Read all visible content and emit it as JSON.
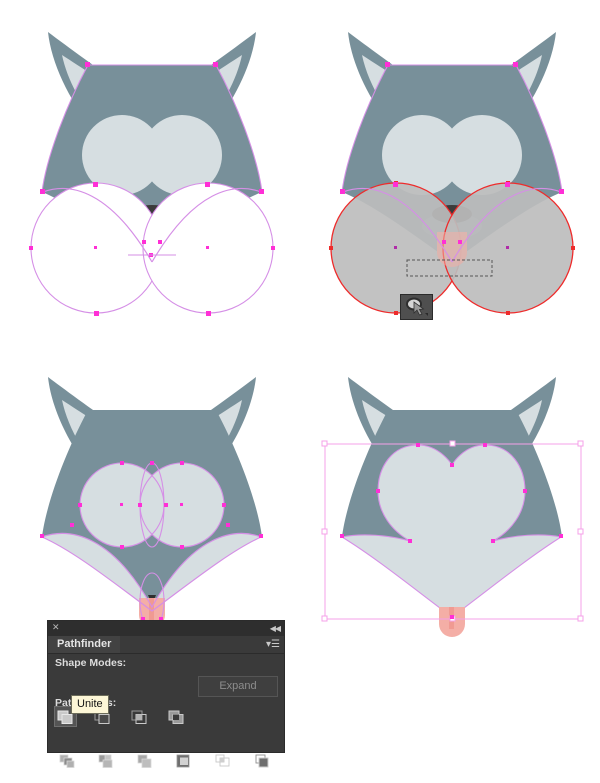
{
  "app": {
    "context": "Adobe Illustrator vector artwork — four stages of building a fox/husky head with the Pathfinder Unite operation"
  },
  "colors": {
    "canvas": "#ffffff",
    "fur_dark": "#78909a",
    "fur_light": "#d6dee1",
    "nose_dark": "#3b3b3b",
    "muzzle_shadow": "#8ca3ad",
    "tongue_pink": "#f4aea6",
    "path_outline": "#e08cf0",
    "anchor_point": "#ff2fd6",
    "selection_red": "#ee2b2b",
    "selection_fill_gray": "#bdbdbd",
    "bbox_pink": "#f5a0e8",
    "panel_bg": "#3a3a3a",
    "panel_titlebar": "#2e2e2e",
    "panel_tab_bg": "#424242",
    "panel_text": "#e4e4e4",
    "tooltip_bg": "#fdf7d7",
    "tooltip_text": "#111111",
    "expand_disabled_text": "#8d8d8d"
  },
  "figures": [
    {
      "id": "step-1",
      "name": "fox-head-with-two-circles",
      "description": "Fox head with two overlapping circle paths drawn over the lower cheeks, shown as unfilled outlines with magenta anchor points"
    },
    {
      "id": "step-2",
      "name": "fox-head-circles-selected",
      "description": "Both circles selected: red path outlines, gray fill, dashed marquee selection rectangle and the Unite tool cursor badge"
    },
    {
      "id": "step-3",
      "name": "fox-head-after-unite-outlines",
      "description": "After Unite the cheeks merge into the light muzzle shape; remaining circle construction paths still visible"
    },
    {
      "id": "step-4",
      "name": "fox-head-final-with-bbox",
      "description": "Final merged heart-shaped muzzle with the selection bounding box and handles shown"
    }
  ],
  "pathfinder_panel": {
    "close_icon": "✕",
    "collapse_icon": "◀◀",
    "tab_label": "Pathfinder",
    "menu_icon": "▾☰",
    "shape_modes_label": "Shape Modes:",
    "pathfinders_label": "Pathfinders:",
    "expand_label": "Expand",
    "expand_enabled": false,
    "shape_modes": [
      {
        "name": "unite",
        "label": "Unite",
        "selected": true
      },
      {
        "name": "minus-front",
        "label": "Minus Front",
        "selected": false
      },
      {
        "name": "intersect",
        "label": "Intersect",
        "selected": false
      },
      {
        "name": "exclude",
        "label": "Exclude",
        "selected": false
      }
    ],
    "pathfinders": [
      {
        "name": "divide",
        "label": "Divide"
      },
      {
        "name": "trim",
        "label": "Trim"
      },
      {
        "name": "merge",
        "label": "Merge"
      },
      {
        "name": "crop",
        "label": "Crop"
      },
      {
        "name": "outline",
        "label": "Outline"
      },
      {
        "name": "minus-back",
        "label": "Minus Back"
      }
    ]
  },
  "tooltip": {
    "text": "Unite",
    "target": "unite-shape-mode-button"
  },
  "tool_badge": {
    "name": "unite-cursor-badge",
    "description": "Small dark square tool badge showing the Unite pathfinder cursor"
  }
}
